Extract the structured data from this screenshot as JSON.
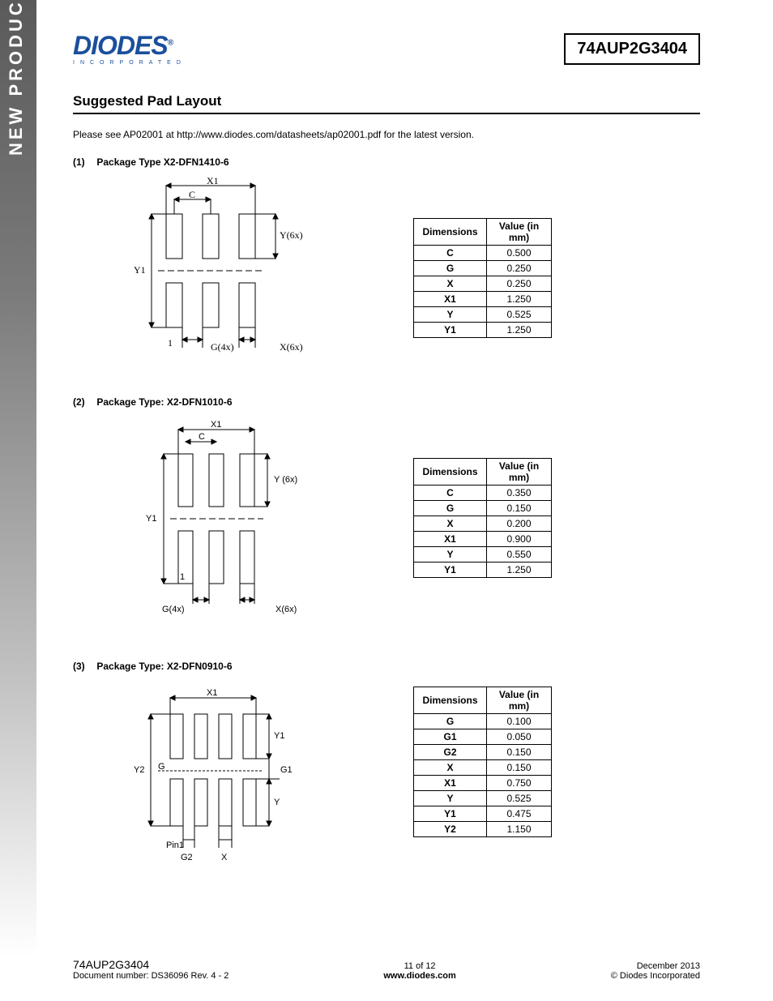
{
  "side_banner": "NEW PRODUCT",
  "logo": {
    "main": "DIODES",
    "sub": "INCORPORATED",
    "reg": "®"
  },
  "part_number": "74AUP2G3404",
  "section_title": "Suggested Pad Layout",
  "intro_text": "Please see AP02001 at http://www.diodes.com/datasheets/ap02001.pdf for the latest version.",
  "packages": [
    {
      "num": "(1)",
      "title": "Package Type X2-DFN1410-6",
      "dim_header": [
        "Dimensions",
        "Value (in mm)"
      ],
      "labels": {
        "x1": "X1",
        "c": "C",
        "y1": "Y1",
        "ylbl": "Y(6x)",
        "one": "1",
        "g": "G(4x)",
        "x": "X(6x)"
      },
      "rows": [
        [
          "C",
          "0.500"
        ],
        [
          "G",
          "0.250"
        ],
        [
          "X",
          "0.250"
        ],
        [
          "X1",
          "1.250"
        ],
        [
          "Y",
          "0.525"
        ],
        [
          "Y1",
          "1.250"
        ]
      ]
    },
    {
      "num": "(2)",
      "title": "Package Type: X2-DFN1010-6",
      "dim_header": [
        "Dimensions",
        "Value (in mm)"
      ],
      "labels": {
        "x1": "X1",
        "c": "C",
        "y1": "Y1",
        "ylbl": "Y (6x)",
        "one": "1",
        "g": "G(4x)",
        "x": "X(6x)"
      },
      "rows": [
        [
          "C",
          "0.350"
        ],
        [
          "G",
          "0.150"
        ],
        [
          "X",
          "0.200"
        ],
        [
          "X1",
          "0.900"
        ],
        [
          "Y",
          "0.550"
        ],
        [
          "Y1",
          "1.250"
        ]
      ]
    },
    {
      "num": "(3)",
      "title": "Package Type: X2-DFN0910-6",
      "dim_header": [
        "Dimensions",
        "Value (in mm)"
      ],
      "labels": {
        "x1": "X1",
        "y1": "Y1",
        "y2": "Y2",
        "g": "G",
        "g1": "G1",
        "g2": "G2",
        "x": "X",
        "y": "Y",
        "pin1": "Pin1"
      },
      "rows": [
        [
          "G",
          "0.100"
        ],
        [
          "G1",
          "0.050"
        ],
        [
          "G2",
          "0.150"
        ],
        [
          "X",
          "0.150"
        ],
        [
          "X1",
          "0.750"
        ],
        [
          "Y",
          "0.525"
        ],
        [
          "Y1",
          "0.475"
        ],
        [
          "Y2",
          "1.150"
        ]
      ]
    }
  ],
  "footer": {
    "left1": "74AUP2G3404",
    "left2": "Document number: DS36096  Rev. 4 - 2",
    "center1": "11 of 12",
    "center2": "www.diodes.com",
    "right1": "December 2013",
    "right2": "© Diodes Incorporated"
  }
}
